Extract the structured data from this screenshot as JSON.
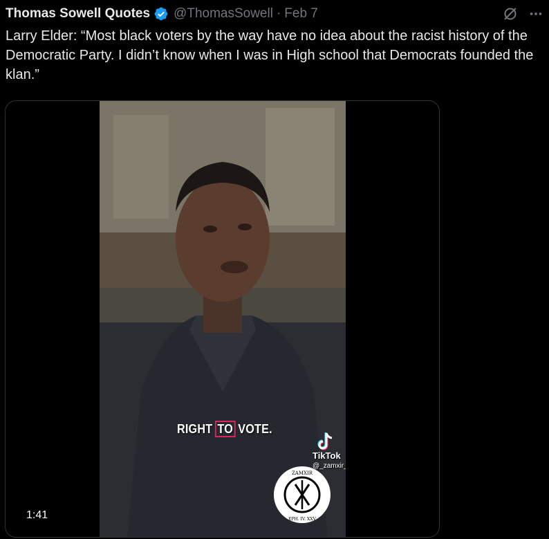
{
  "tweet": {
    "author_name": "Thomas Sowell Quotes",
    "handle": "@ThomasSowell",
    "separator": "·",
    "date": "Feb 7",
    "text": "Larry Elder: “Most black voters by the way have no idea about the racist history of the Democratic Party. I didn’t know when I was in High school that Democrats founded the klan.”"
  },
  "icons": {
    "verified": "verified-badge-icon",
    "grok": "grok-icon",
    "more": "more-options-icon"
  },
  "colors": {
    "background": "#000000",
    "text": "#e7e9ea",
    "secondary": "#71767b",
    "verified_blue": "#1d9bf0",
    "border": "#2f3336"
  },
  "video": {
    "caption_before": "RIGHT",
    "caption_highlight": "TO",
    "caption_after": "VOTE.",
    "watermark_app": "TikTok",
    "watermark_user": "@_zamxir_",
    "seal_top_text": "ZAMXIR",
    "seal_bottom_text": "EPH. IV. XXV",
    "duration": "1:41"
  }
}
